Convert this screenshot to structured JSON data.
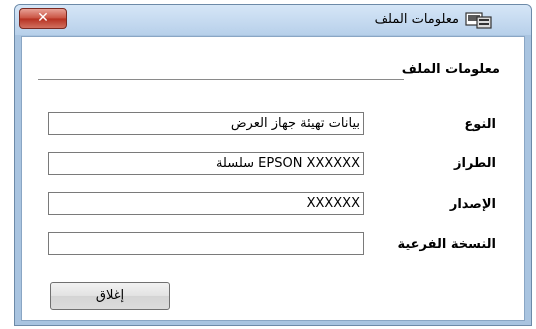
{
  "window": {
    "title": "معلومات الملف",
    "icon": "file-info-icon",
    "close_glyph": "✕"
  },
  "group": {
    "label": "معلومات الملف"
  },
  "fields": [
    {
      "label": "النوع",
      "value": "بيانات تهيئة جهاز العرض"
    },
    {
      "label": "الطراز",
      "value": "EPSON XXXXXX سلسلة"
    },
    {
      "label": "الإصدار",
      "value": "XXXXXX"
    },
    {
      "label": "النسخة الفرعية",
      "value": ""
    }
  ],
  "buttons": {
    "close_label": "إغلاق"
  },
  "colors": {
    "title_bar": "#b7d0ea",
    "close_button": "#c8503f",
    "frame": "#a9c4e0"
  }
}
